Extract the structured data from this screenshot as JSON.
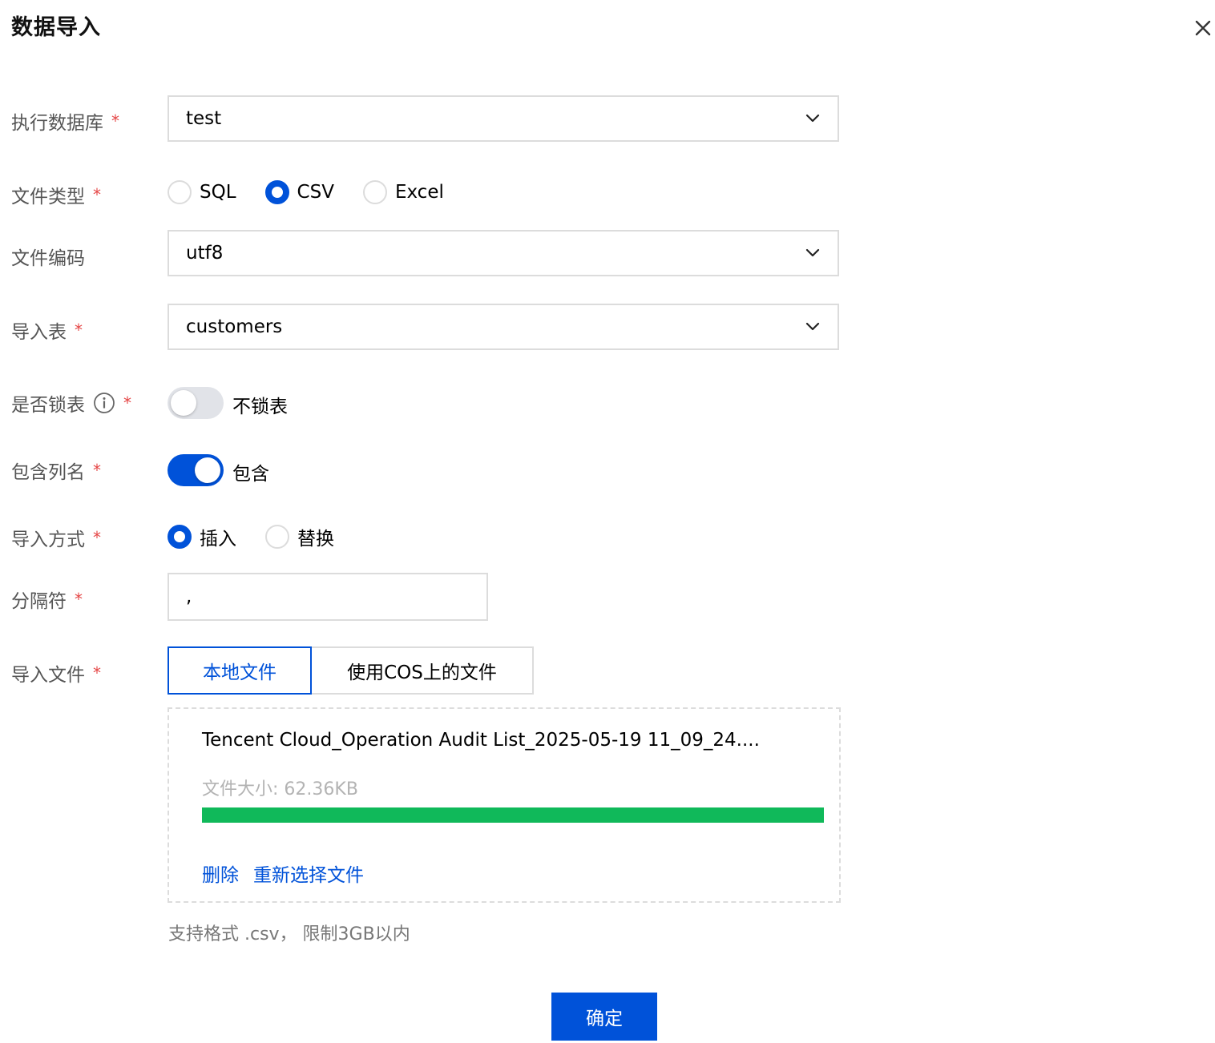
{
  "dialog": {
    "title": "数据导入"
  },
  "form": {
    "database": {
      "label": "执行数据库",
      "required_mark": "*",
      "value": "test"
    },
    "file_type": {
      "label": "文件类型",
      "required_mark": "*",
      "options": [
        "SQL",
        "CSV",
        "Excel"
      ],
      "selected": "CSV"
    },
    "encoding": {
      "label": "文件编码",
      "value": "utf8"
    },
    "table": {
      "label": "导入表",
      "required_mark": "*",
      "value": "customers"
    },
    "lock_table": {
      "label": "是否锁表",
      "required_mark": "*",
      "enabled": false,
      "text": "不锁表",
      "info_icon": "info-circle-icon"
    },
    "include_columns": {
      "label": "包含列名",
      "required_mark": "*",
      "enabled": true,
      "text": "包含"
    },
    "import_mode": {
      "label": "导入方式",
      "required_mark": "*",
      "options": [
        "插入",
        "替换"
      ],
      "selected": "插入"
    },
    "delimiter": {
      "label": "分隔符",
      "required_mark": "*",
      "value": ","
    },
    "import_file": {
      "label": "导入文件",
      "required_mark": "*",
      "tabs": [
        "本地文件",
        "使用COS上的文件"
      ],
      "active_tab": "本地文件"
    }
  },
  "upload": {
    "file_name": "Tencent Cloud_Operation Audit List_2025-05-19 11_09_24....",
    "file_size_text": "文件大小: 62.36KB",
    "progress_percent": 100,
    "delete_label": "删除",
    "reselect_label": "重新选择文件",
    "hint": "支持格式 .csv， 限制3GB以内"
  },
  "confirm_label": "确定",
  "colors": {
    "primary": "#0052d9",
    "required": "#e54545",
    "success": "#10b95a",
    "border": "#dcdcdc"
  }
}
